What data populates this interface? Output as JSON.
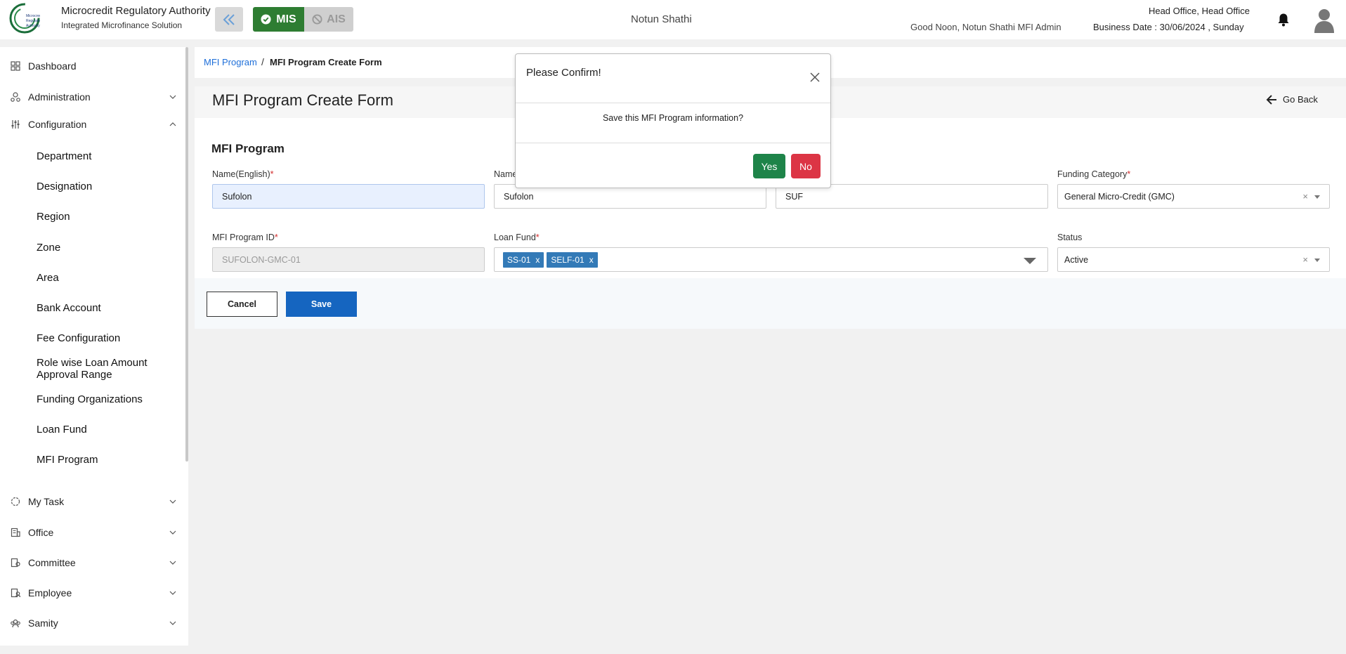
{
  "header": {
    "brand_title": "Microcredit Regulatory Authority",
    "brand_subtitle": "Integrated Microfinance Solution",
    "logo_text": "Microcredit Regulatory Authority",
    "mis_label": "MIS",
    "ais_label": "AIS",
    "organization": "Notun Shathi",
    "greeting": "Good Noon, Notun Shathi MFI Admin",
    "office": "Head Office, Head Office",
    "business_date": "Business Date : 30/06/2024 , Sunday"
  },
  "sidebar": {
    "items": [
      {
        "label": "Dashboard",
        "icon": "dashboard-icon"
      },
      {
        "label": "Administration",
        "icon": "administration-icon"
      },
      {
        "label": "Configuration",
        "icon": "configuration-icon"
      }
    ],
    "config_subitems": [
      "Department",
      "Designation",
      "Region",
      "Zone",
      "Area",
      "Bank Account",
      "Fee Configuration",
      "Role wise Loan Amount Approval Range",
      "Funding Organizations",
      "Loan Fund",
      "MFI Program"
    ],
    "bottom_items": [
      {
        "label": "My Task",
        "icon": "task-icon"
      },
      {
        "label": "Office",
        "icon": "office-icon"
      },
      {
        "label": "Committee",
        "icon": "committee-icon"
      },
      {
        "label": "Employee",
        "icon": "employee-icon"
      },
      {
        "label": "Samity",
        "icon": "samity-icon"
      }
    ]
  },
  "breadcrumb": {
    "link": "MFI Program",
    "separator": "/",
    "current": "MFI Program Create Form"
  },
  "form": {
    "title": "MFI Program Create Form",
    "go_back": "Go Back",
    "section_title": "MFI Program",
    "fields": {
      "name_english": {
        "label": "Name(English)",
        "value": "Sufolon"
      },
      "name_bangla": {
        "label": "Name",
        "value": "Sufolon"
      },
      "short_name": {
        "value": "SUF"
      },
      "funding_category": {
        "label": "Funding Category",
        "value": "General Micro-Credit (GMC)"
      },
      "program_id": {
        "label": "MFI Program ID",
        "value": "SUFOLON-GMC-01"
      },
      "loan_fund": {
        "label": "Loan Fund",
        "tags": [
          "SS-01",
          "SELF-01"
        ]
      },
      "status": {
        "label": "Status",
        "value": "Active"
      }
    },
    "required_mark": "*",
    "cancel_label": "Cancel",
    "save_label": "Save"
  },
  "modal": {
    "title": "Please Confirm!",
    "message": "Save this MFI Program information?",
    "yes_label": "Yes",
    "no_label": "No"
  },
  "colors": {
    "mis_green": "#2e7d32",
    "save_blue": "#1565c0",
    "yes_green": "#1e8449",
    "no_red": "#dc3545",
    "link_blue": "#1e6fd9"
  }
}
